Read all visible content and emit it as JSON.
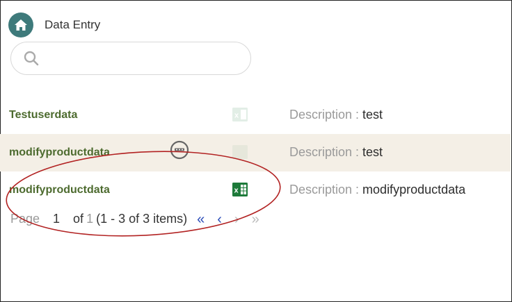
{
  "header": {
    "title": "Data Entry",
    "home_icon": "home-icon"
  },
  "search": {
    "placeholder": "",
    "value": ""
  },
  "rows": [
    {
      "name": "Testuserdata",
      "desc_label": "Description : ",
      "desc_value": "test",
      "excel_state": "faded"
    },
    {
      "name": "modifyproductdata",
      "desc_label": "Description : ",
      "desc_value": "test",
      "excel_state": "hidden",
      "has_more_menu": true
    },
    {
      "name": "modifyproductdata",
      "desc_label": "Description : ",
      "desc_value": "modifyproductdata",
      "excel_state": "active"
    }
  ],
  "pagination": {
    "page_label": "Page",
    "current_page": "1",
    "of_label": "of",
    "total_pages": "1",
    "items_info": "(1 - 3 of 3 items)"
  },
  "colors": {
    "accent_teal": "#3e7a7b",
    "name_green": "#4d6b2f",
    "row_highlight": "#f4efe6",
    "excel_green": "#1d7a3a",
    "annotation_red": "#b22222",
    "nav_blue": "#2a4bb8"
  }
}
